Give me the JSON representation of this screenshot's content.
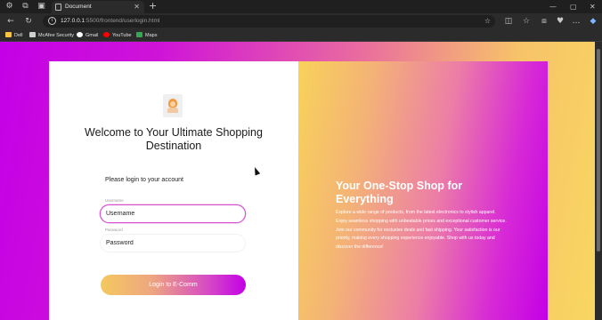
{
  "browser": {
    "tab_title": "Document",
    "url_host": "127.0.0.1",
    "url_rest": ":5500/frontend/userlogin.html",
    "tab_close_glyph": "✕",
    "new_tab_glyph": "+",
    "window_controls": [
      "—",
      "▢",
      "✕"
    ],
    "bookmarks": [
      {
        "label": "Dell",
        "icon": "folder-icon",
        "color": "#f5c542"
      },
      {
        "label": "McAfee Security",
        "icon": "page-icon",
        "color": "#d0d0d0"
      },
      {
        "label": "Gmail",
        "icon": "google-icon",
        "color": "#ffffff"
      },
      {
        "label": "YouTube",
        "icon": "youtube-icon",
        "color": "#ff0000"
      },
      {
        "label": "Maps",
        "icon": "maps-icon",
        "color": "#34a853"
      }
    ]
  },
  "login": {
    "heading": "Welcome to Your Ultimate Shopping Destination",
    "subheading": "Please login to your account",
    "username_label": "Username",
    "username_placeholder": "Username",
    "password_label": "Password",
    "password_placeholder": "Password",
    "button_label": "Login to E-Comm"
  },
  "promo": {
    "title": "Your One-Stop Shop for Everything",
    "text": "Explore a wide range of products, from the latest electronics to stylish apparel. Enjoy seamless shopping with unbeatable prices and exceptional customer service. Join our community for exclusive deals and fast shipping. Your satisfaction is our priority, making every shopping experience enjoyable. Shop with us today and discover the difference!"
  },
  "colors": {
    "accent_purple": "#c400e6",
    "accent_yellow": "#f8d25a"
  }
}
